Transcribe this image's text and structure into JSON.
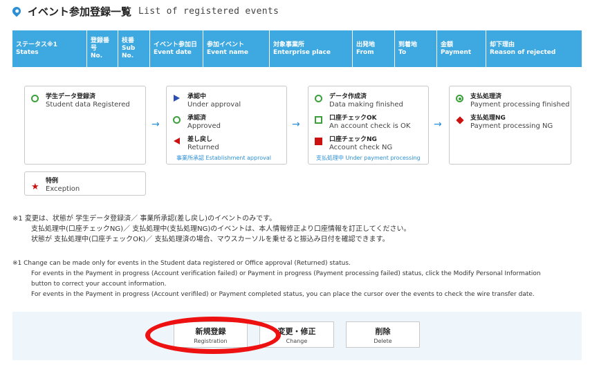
{
  "title": {
    "jp": "イベント参加登録一覧",
    "en": "List of registered events"
  },
  "header": {
    "columns": [
      {
        "jp": "ステータス※1",
        "en": "States"
      },
      {
        "jp": "登録番号",
        "en": "No."
      },
      {
        "jp": "枝番",
        "en": "Sub No."
      },
      {
        "jp": "イベント参加日",
        "en": "Event date"
      },
      {
        "jp": "参加イベント",
        "en": "Event name"
      },
      {
        "jp": "対象事業所",
        "en": "Enterprise place"
      },
      {
        "jp": "出発地",
        "en": "From"
      },
      {
        "jp": "到着地",
        "en": "To"
      },
      {
        "jp": "金額",
        "en": "Payment"
      },
      {
        "jp": "却下理由",
        "en": "Reason of rejected"
      }
    ]
  },
  "legend": {
    "student": {
      "jp": "学生データ登録済",
      "en": "Student data Registered"
    },
    "under_approval": {
      "jp": "承認中",
      "en": "Under approval"
    },
    "approved": {
      "jp": "承認済",
      "en": "Approved"
    },
    "returned": {
      "jp": "差し戻し",
      "en": "Returned"
    },
    "establishment_caption": "事業所承認 Establishment approval",
    "data_making": {
      "jp": "データ作成済",
      "en": "Data making finished"
    },
    "account_ok": {
      "jp": "口座チェックOK",
      "en": "An account check is OK"
    },
    "account_ng": {
      "jp": "口座チェックNG",
      "en": "Account check NG"
    },
    "under_payment_caption": "支払処理中 Under payment processing",
    "payment_finished": {
      "jp": "支払処理済",
      "en": "Payment processing finished"
    },
    "payment_ng": {
      "jp": "支払処理NG",
      "en": "Payment processing NG"
    },
    "exception": {
      "jp": "特例",
      "en": "Exception"
    },
    "arrow": "→"
  },
  "notes": {
    "jp": [
      "※1 変更は、状態が 学生データ登録済／ 事業所承認(差し戻し)のイベントのみです。",
      "支払処理中(口座チェックNG)／ 支払処理中(支払処理NG)のイベントは、本人情報修正より口座情報を訂正してください。",
      "状態が 支払処理中(口座チェックOK)／ 支払処理済の場合、マウスカーソルを乗せると振込み日付を確認できます。"
    ],
    "en": [
      "※1  Change can be made only for events in the Student data registered or Office approval (Returned) status.",
      "For events in the Payment in progress (Account verification failed) or Payment in progress (Payment processing failed) status, click the Modify Personal Information",
      "button to correct your account information.",
      "For events in the Payment in progress (Account verifiled) or Payment completed status, you can place the cursor over the events to check the wire transfer date."
    ]
  },
  "buttons": {
    "register": {
      "jp": "新規登録",
      "en": "Registration"
    },
    "change": {
      "jp": "変更・修正",
      "en": "Change"
    },
    "delete": {
      "jp": "削除",
      "en": "Delete"
    }
  },
  "colors": {
    "accent": "#3ea8e0",
    "highlight": "#ee1111"
  }
}
